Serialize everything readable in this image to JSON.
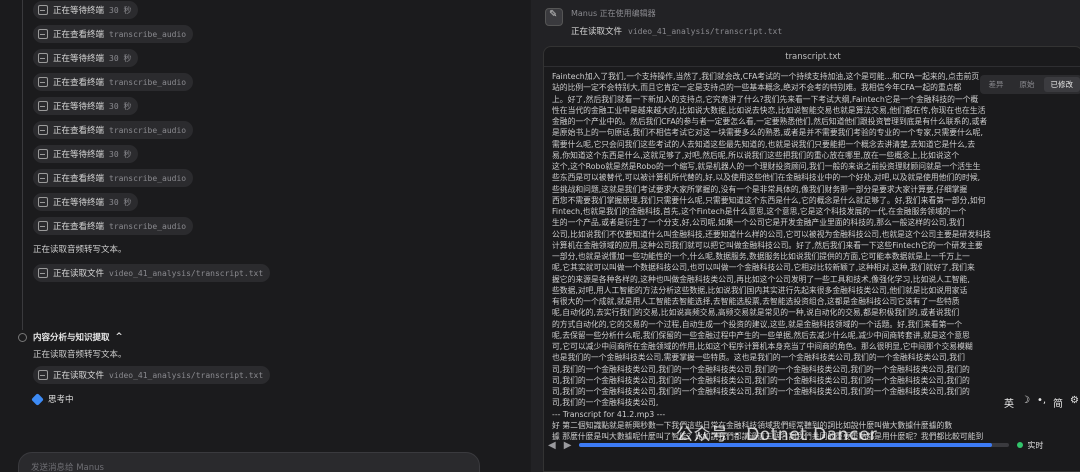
{
  "left": {
    "steps": [
      {
        "kind": "chip",
        "verb": "正在等待终端",
        "arg": "30 秒"
      },
      {
        "kind": "chip",
        "verb": "正在查看终端",
        "arg": "transcribe_audio"
      },
      {
        "kind": "chip",
        "verb": "正在等待终端",
        "arg": "30 秒"
      },
      {
        "kind": "chip",
        "verb": "正在查看终端",
        "arg": "transcribe_audio"
      },
      {
        "kind": "chip",
        "verb": "正在等待终端",
        "arg": "30 秒"
      },
      {
        "kind": "chip",
        "verb": "正在查看终端",
        "arg": "transcribe_audio"
      },
      {
        "kind": "chip",
        "verb": "正在等待终端",
        "arg": "30 秒"
      },
      {
        "kind": "chip",
        "verb": "正在查看终端",
        "arg": "transcribe_audio"
      },
      {
        "kind": "chip",
        "verb": "正在等待终端",
        "arg": "30 秒"
      },
      {
        "kind": "chip",
        "verb": "正在查看终端",
        "arg": "transcribe_audio"
      },
      {
        "kind": "text",
        "text": "正在读取音频转写文本。"
      },
      {
        "kind": "chip",
        "verb": "正在读取文件",
        "arg": "video_41_analysis/transcript.txt"
      }
    ],
    "section_title": "内容分析与知识提取",
    "section_chevron": "^",
    "section_desc": "正在读取音频转写文本。",
    "section_chip": {
      "verb": "正在读取文件",
      "arg": "video_41_analysis/transcript.txt"
    },
    "thinking": "思考中",
    "composer_placeholder": "发送消息给 Manus"
  },
  "right": {
    "status": "Manus 正在使用编辑器",
    "action": "正在读取文件",
    "action_arg": "video_41_analysis/transcript.txt",
    "doc_title": "transcript.txt",
    "modes": [
      "差异",
      "原始",
      "已修改"
    ],
    "lines": [
      "Faintech加入了我们,一个支持操作,当然了,我们就会改,CFA考试的一个持续支持加油,这个是可能...和CFA一起来的,点击前页",
      "站的比例一定不会特别大,而且它肯定一定是支持点的一些基本概念,绝对不会考的特别难。我相信今年CFA一起的重点都",
      "上。好了,然后我们就看一下新加入的支持点,它究竟讲了什么?我们先来看一下考试大纲,Faintech它是一个金融科技的一个概",
      "性在当代的金融工业中是越来越大的,比如说大数据,比如说去快恋,比如说智能交易也就是算法交易,他们都在传,你现在也在生活",
      "金融的一个产业中的。然后我们CFA的参与者一定要怎么看,一定要熟悉他们,然后知道他们跟投资管理到底是有什么联系的,或者",
      "是原始书上的一句原话,我们不相信考试它对这一块需要多么的熟悉,或者是并不需要我们考验的专业的一个专家,只需要什么呢,",
      "需要什么呢,它只会问我们这些考试的人去知道这些最先知道的,也就是说我们只要能把一个概念去讲清楚,去知道它是什么,去",
      "易,你知道这个东西是什么,这就足够了,对吧,然后呢,所以说我们这些把我们的重心放在哪里,放在一些概念上,比如说这个",
      "这个,这个Robo就是然是Robo的一个缩写,就是机器人的一个理财投资顾问,我们一般的来说之前投资理财顾问就是一个活生生",
      "些东西是可以被替代,可以被计算机所代替的,好,以及使用这些他们在金融科技业中的一个好处,对吧,以及就是使用他们的时候,",
      "些挑战和问题,这就是我们考试要求大家所掌握的,没有一个是非常具体的,像我们财务那一部分是要求大家计算要,仔细掌握",
      "西您不需要我们掌握原理,我们只需要什么呢,只需要知道这个东西是什么,它的概念是什么就足够了。好,我们来看第一部分,如何",
      "Fintech,也就是我们的金融科技,首先,这个Fintech是什么意思,这个意思,它是这个科技发展的一代,在金融服务领域的一个",
      "生的一个产品,或者是衍生了一个分支,好,公司呢,如果一个公司它是开发金融产业里面的科技的,那么一般这样的公司,我们",
      "公司,比如说我们不仅要知道什么叫金融科技,还要知道什么样的公司,它可以被视为金融科技公司,也就是这个公司主要是研发科技",
      "计算机在金融领域的应用,这种公司我们就可以把它叫做金融科技公司。好了,然后我们来看一下这些Fintech它的一个研发主要",
      "一部分,也就是说懂加一些功能性的一个,什么呢,数据服务,数据服务比如说我们提供的方面,它可能本数据就是上一千万上一",
      "呢,它其实就可以叫做一个数据科技公司,也可以叫做一个金融科技公司,它相对比较新颖了,这种相对,这种,我们就好了,我们来",
      "握它的来源是各种各样的,这种也叫做金融科技类公司,再比如这个公司发明了一些工具和技术,像强化学习,比如说人工智能,",
      "些数据,对吧,用人工智能的方法分析这些数据,比如说我们国内其实进行先起来很多金融科技类公司,他们就是比如说用家话",
      "有很大的一个成就,就是用人工智能去智能选择,去智能选股票,去智能选投资组合,这都是金融科技公司它该有了一些特质",
      "呢,自动化的,去实行我们的交易,比如说高频交易,高频交易就是常见的一种,说自动化的交易,都是积极我们的,或者说我们",
      "的方式自动化的,它的交易的一个过程,自动生成一个投资的建议,这些,就是金融科技领域的一个话题。好,我们来看第一个",
      "呢,去保留一些分析什么呢,我们保留的一些金融过程中产生的一些单据,然后去减少什么呢,减少中间商转套讲,就是这个意思",
      "可,它可以减少中间商所在金融领域的作用,比如这个程序计算机本身充当了中间商的角色。那么很明显,它中间那个交易模糊",
      "也是我们的一个金融科技类公司,需要掌握一些特质。这也是我们的一个金融科技类公司,我们的一个金融科技类公司,我们",
      "司,我们的一个金融科技类公司,我们的一个金融科技类公司,我们的一个金融科技类公司,我们的一个金融科技类公司,我们的",
      "司,我们的一个金融科技类公司,我们的一个金融科技类公司,我们的一个金融科技类公司,我们的一个金融科技类公司,我们的",
      "司,我们的一个金融科技类公司,我们的一个金融科技类公司,我们的一个金融科技类公司,我们的一个金融科技类公司,我们的",
      "司,我们的一个金融科技类公司,",
      "--- Transcript for 41.2.mp3 ---",
      "好 第二個知識點就是新興秒數一下我們這些日常在金融科技領域我們經常聽到的詞比如說什麼叫做大數據什麼據的數",
      "據 那麼什麼是叫大數據呢什麼叫了智能？比如說我們都講過這三個名詞我們共同的重要重點都是用什麼呢？我們都比較可能到"
    ],
    "tools": [
      "英",
      "☽",
      "•,",
      "简",
      "⚙"
    ],
    "player": {
      "prev": "◀",
      "next": "▶",
      "progress": 0.96,
      "live": "实时"
    },
    "watermark": "公众号 · Dotnet Dancer"
  }
}
